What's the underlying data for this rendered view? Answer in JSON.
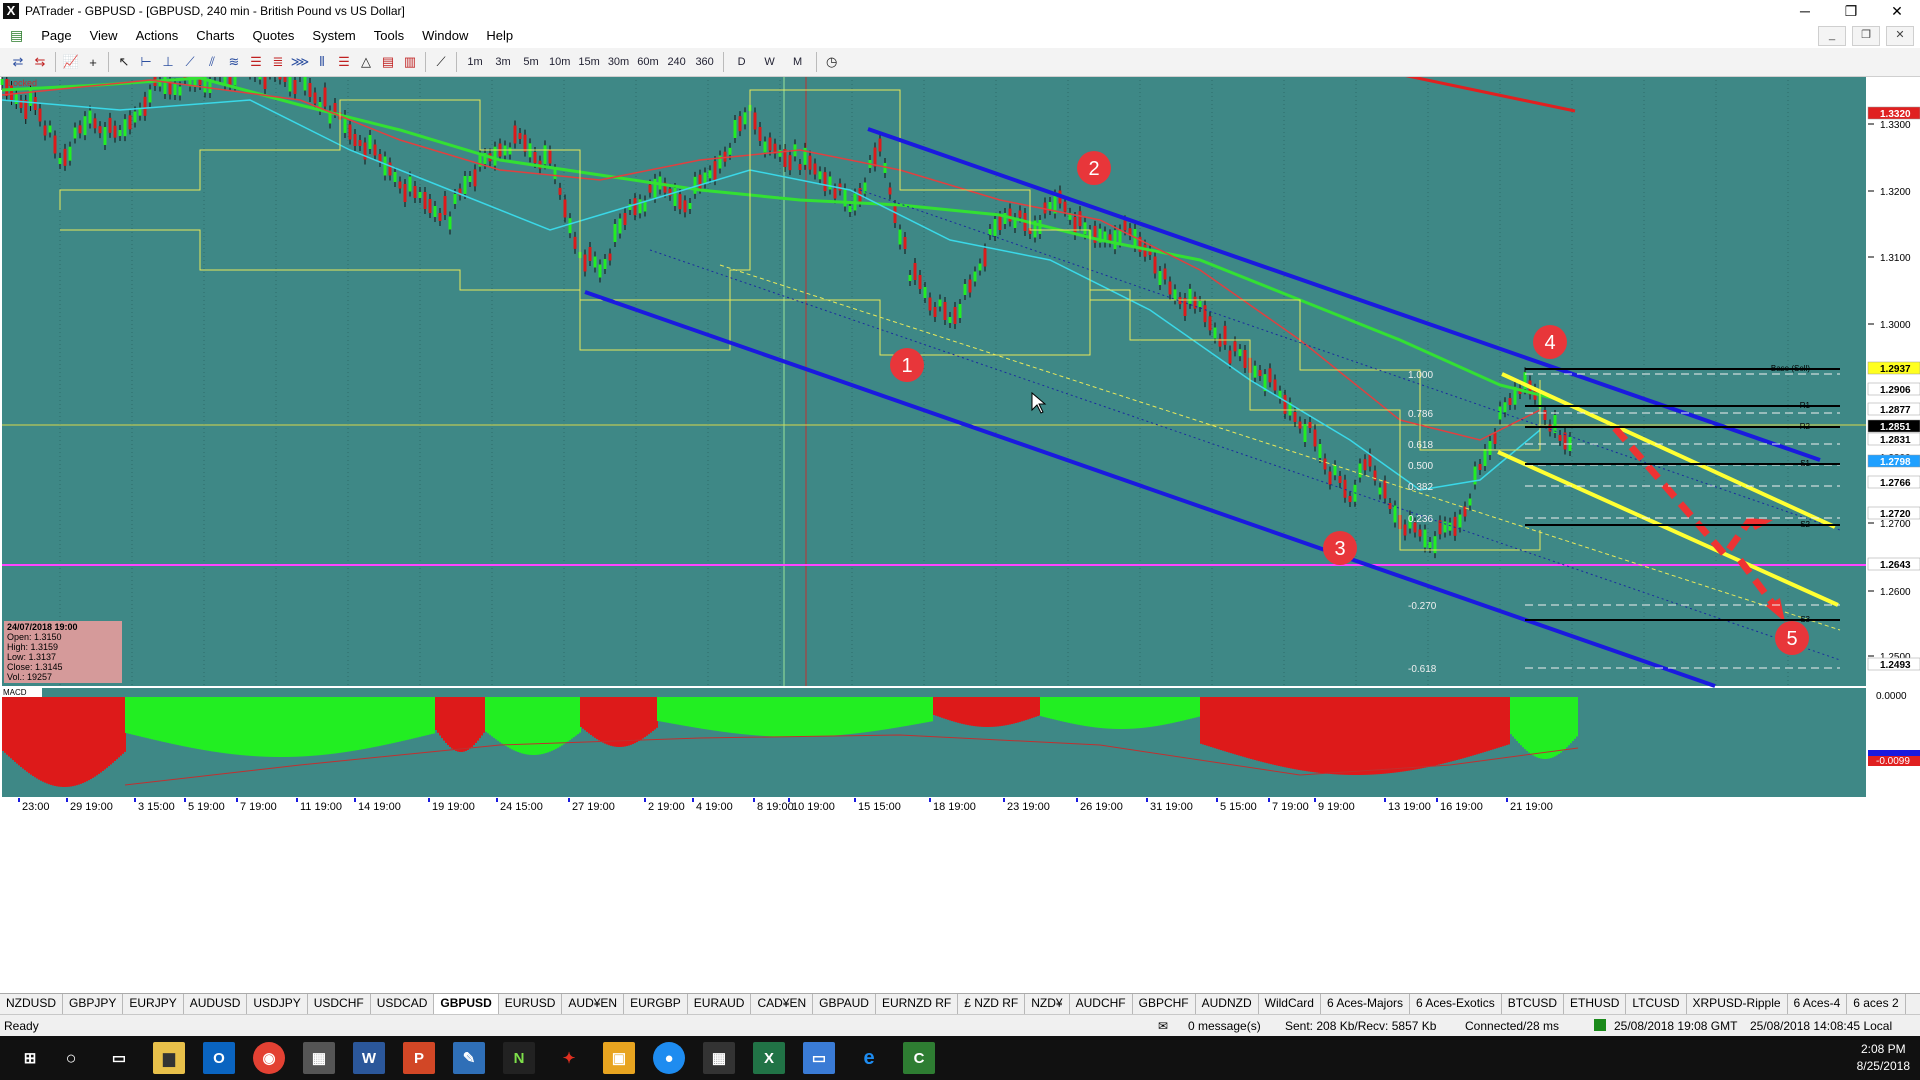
{
  "window": {
    "title": "PATrader - GBPUSD - [GBPUSD, 240 min - British Pound vs US Dollar]",
    "app_icon": "X"
  },
  "menu": [
    "Page",
    "View",
    "Actions",
    "Charts",
    "Quotes",
    "System",
    "Tools",
    "Window",
    "Help"
  ],
  "toolbar": {
    "timeframes": [
      "1m",
      "3m",
      "5m",
      "10m",
      "15m",
      "30m",
      "60m",
      "240",
      "360"
    ],
    "periods": [
      "D",
      "W",
      "M"
    ]
  },
  "chart": {
    "data_tag": "Data",
    "locked_label": "Locked",
    "index_label": "INDEX",
    "macd_label": "MACD",
    "price_labels": [
      "1.3300",
      "1.3200",
      "1.3100",
      "1.3000",
      "1.2900",
      "1.2800",
      "1.2700",
      "1.2600",
      "1.2500"
    ],
    "highlight_labels": [
      {
        "text": "1.3320",
        "bg": "#e02020",
        "fg": "#ffffff"
      },
      {
        "text": "1.2937",
        "bg": "#ffff20",
        "fg": "#000000"
      },
      {
        "text": "1.2906",
        "bg": "#ffffff",
        "fg": "#000000"
      },
      {
        "text": "1.2877",
        "bg": "#ffffff",
        "fg": "#000000"
      },
      {
        "text": "1.2851",
        "bg": "#000000",
        "fg": "#ffffff"
      },
      {
        "text": "1.2831",
        "bg": "#ffffff",
        "fg": "#000000"
      },
      {
        "text": "1.2798",
        "bg": "#1fa0ff",
        "fg": "#ffffff"
      },
      {
        "text": "1.2766",
        "bg": "#ffffff",
        "fg": "#000000"
      },
      {
        "text": "1.2720",
        "bg": "#ffffff",
        "fg": "#000000"
      },
      {
        "text": "1.2643",
        "bg": "#ffffff",
        "fg": "#000000"
      },
      {
        "text": "1.2493",
        "bg": "#ffffff",
        "fg": "#000000"
      }
    ],
    "macd_labels": [
      "0.0000",
      "-0.0099"
    ],
    "fib_labels": [
      "1.000",
      "0.786",
      "0.618",
      "0.500",
      "0.382",
      "0.236",
      "-0.270",
      "-0.618"
    ],
    "pivot_labels": [
      "Base (Sell)",
      "R1",
      "R2",
      "S1",
      "S2",
      "S3"
    ],
    "markers": [
      "1",
      "2",
      "3",
      "4",
      "5"
    ],
    "time_labels": [
      "23:00",
      "29 19:00",
      "3 15:00",
      "5 19:00",
      "7 19:00",
      "11 19:00",
      "14 19:00",
      "19 19:00",
      "24 15:00",
      "27 19:00",
      "2 19:00",
      "4 19:00",
      "8 19:00",
      "10 19:00",
      "15 15:00",
      "18 19:00",
      "23 19:00",
      "26 19:00",
      "31 19:00",
      "5 15:00",
      "7 19:00",
      "9 19:00",
      "13 19:00",
      "16 19:00",
      "21 19:00"
    ],
    "info_box": {
      "date": "24/07/2018 19:00",
      "open": "Open: 1.3150",
      "high": "High: 1.3159",
      "low": "Low: 1.3137",
      "close": "Close: 1.3145",
      "vol": "Vol.: 19257"
    },
    "colors": {
      "background": "#3e8886",
      "bull": "#22ee22",
      "bear": "#dd1a1a",
      "channel": "#1a1adf",
      "arrow": "#ee3333",
      "ribbon": "#ffff33",
      "pink": "#ff44ff"
    }
  },
  "symbol_tabs": [
    "NZDUSD",
    "GBPJPY",
    "EURJPY",
    "AUDUSD",
    "USDJPY",
    "USDCHF",
    "USDCAD",
    "GBPUSD",
    "EURUSD",
    "AUD¥EN",
    "EURGBP",
    "EURAUD",
    "CAD¥EN",
    "GBPAUD",
    "EURNZD RF",
    "£ NZD RF",
    "NZD¥",
    "AUDCHF",
    "GBPCHF",
    "AUDNZD",
    "WildCard",
    "6 Aces-Majors",
    "6 Aces-Exotics",
    "BTCUSD",
    "ETHUSD",
    "LTCUSD",
    "XRPUSD-Ripple",
    "6 Aces-4",
    "6 aces 2"
  ],
  "active_tab": "GBPUSD",
  "status": {
    "ready": "Ready",
    "messages": "0 message(s)",
    "traffic": "Sent: 208 Kb/Recv: 5857 Kb",
    "connection": "Connected/28 ms",
    "gmt": "25/08/2018 19:08 GMT",
    "local": "25/08/2018 14:08:45 Local"
  },
  "taskbar": {
    "time": "2:08 PM",
    "date": "8/25/2018"
  }
}
